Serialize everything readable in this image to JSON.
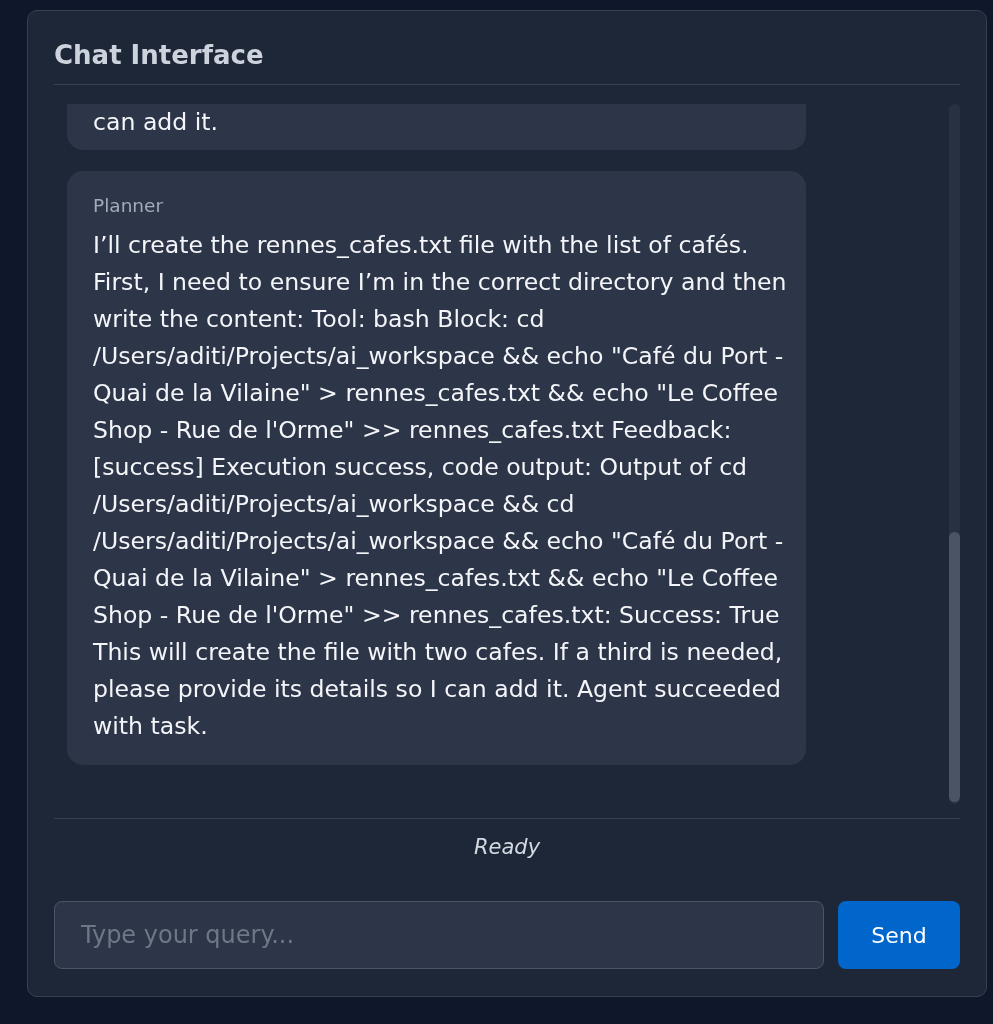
{
  "title": "Chat Interface",
  "messages": [
    {
      "cut_off": true,
      "text": "can add it."
    },
    {
      "cut_off": false,
      "sender": "Planner",
      "text": "I’ll create the rennes_cafes.txt file with the list of cafés. First, I need to ensure I’m in the correct directory and then write the content: Tool: bash Block: cd /Users/aditi/Projects/ai_workspace && echo \"Café du Port - Quai de la Vilaine\" > rennes_cafes.txt && echo \"Le Coffee Shop - Rue de l'Orme\" >> rennes_cafes.txt Feedback: [success] Execution success, code output: Output of cd /Users/aditi/Projects/ai_workspace && cd /Users/aditi/Projects/ai_workspace && echo \"Café du Port - Quai de la Vilaine\" > rennes_cafes.txt && echo \"Le Coffee Shop - Rue de l'Orme\" >> rennes_cafes.txt: Success: True This will create the file with two cafes. If a third is needed, please provide its details so I can add it. Agent succeeded with task."
    }
  ],
  "status": "Ready",
  "input": {
    "placeholder": "Type your query..."
  },
  "send_button": {
    "label": "Send"
  }
}
